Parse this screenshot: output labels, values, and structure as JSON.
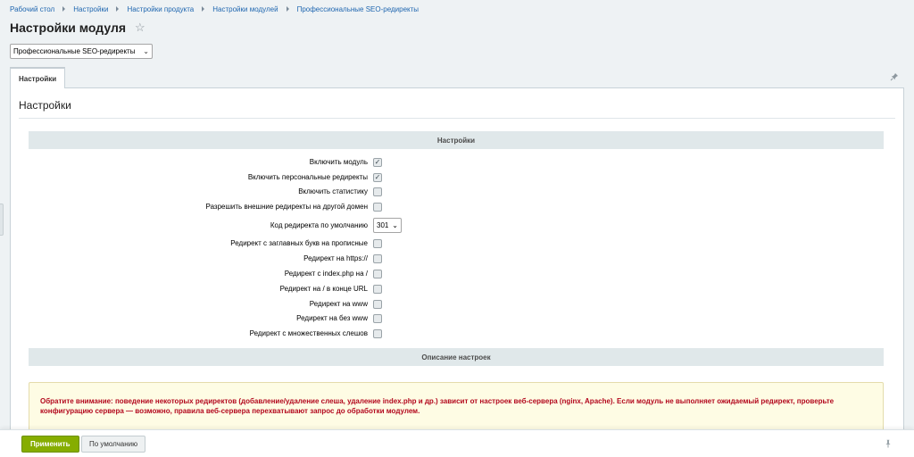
{
  "breadcrumbs": [
    "Рабочий стол",
    "Настройки",
    "Настройки продукта",
    "Настройки модулей",
    "Профессиональные SEO-редиректы"
  ],
  "page": {
    "title": "Настройки модуля"
  },
  "module_select": {
    "value": "Профессиональные SEO-редиректы"
  },
  "tabs": [
    {
      "label": "Настройки",
      "active": true
    }
  ],
  "panel": {
    "title": "Настройки",
    "section_settings": "Настройки",
    "section_description": "Описание настроек"
  },
  "settings": [
    {
      "label": "Включить модуль",
      "checked": true
    },
    {
      "label": "Включить персональные редиректы",
      "checked": true
    },
    {
      "label": "Включить статистику",
      "checked": false
    },
    {
      "label": "Разрешить внешние редиректы на другой домен",
      "checked": false
    },
    {
      "label": "Код редиректа по умолчанию",
      "select": "301"
    },
    {
      "label": "Редирект с заглавных букв на прописные",
      "checked": false
    },
    {
      "label": "Редирект на https://",
      "checked": false
    },
    {
      "label": "Редирект с index.php на /",
      "checked": false
    },
    {
      "label": "Редирект на / в конце URL",
      "checked": false
    },
    {
      "label": "Редирект на www",
      "checked": false
    },
    {
      "label": "Редирект на без www",
      "checked": false
    },
    {
      "label": "Редирект с множественных слешов",
      "checked": false
    }
  ],
  "notice": {
    "text": "Обратите внимание: поведение некоторых редиректов (добавление/удаление слеша, удаление index.php и др.) зависит от настроек веб-сервера (nginx, Apache). Если модуль не выполняет ожидаемый редирект, проверьте конфигурацию сервера — возможно, правила веб-сервера перехватывают запрос до обработки модулем."
  },
  "footer": {
    "apply_label": "Применить",
    "default_label": "По умолчанию"
  },
  "colors": {
    "accent_green": "#86ad00",
    "link_blue": "#2067b0",
    "notice_red": "#b3081d"
  }
}
